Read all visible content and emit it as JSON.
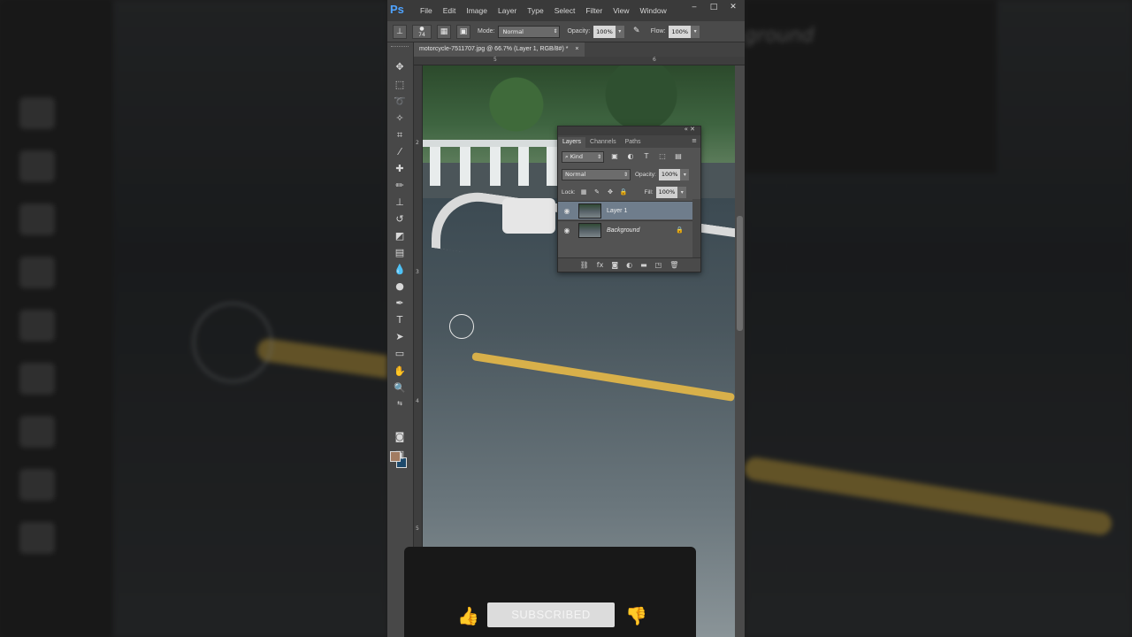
{
  "app": {
    "logo": "Ps",
    "menu": [
      "File",
      "Edit",
      "Image",
      "Layer",
      "Type",
      "Select",
      "Filter",
      "View",
      "Window"
    ],
    "window_controls": [
      "‒",
      "□",
      "✕"
    ]
  },
  "options": {
    "brush_size": "74",
    "mode_label": "Mode:",
    "mode_value": "Normal",
    "opacity_label": "Opacity:",
    "opacity_value": "100%",
    "flow_label": "Flow:",
    "flow_value": "100%"
  },
  "document": {
    "tab_title": "motorcycle-7511707.jpg @ 66.7% (Layer 1, RGB/8#) *",
    "tab_close": "×",
    "ruler_top": [
      "5",
      "6"
    ],
    "ruler_left": [
      "2",
      "3",
      "4",
      "5"
    ]
  },
  "colors": {
    "foreground": "#a27c62",
    "background": "#1e4a6c",
    "accent": "#4fa3ff"
  },
  "layers_panel": {
    "tabs": [
      "Layers",
      "Channels",
      "Paths"
    ],
    "filter_value": "Kind",
    "blend_mode": "Normal",
    "opacity_label": "Opacity:",
    "opacity_value": "100%",
    "lock_label": "Lock:",
    "fill_label": "Fill:",
    "fill_value": "100%",
    "layers": [
      {
        "name": "Layer 1",
        "selected": true,
        "locked": false
      },
      {
        "name": "Background",
        "selected": false,
        "locked": true
      }
    ]
  },
  "background_panel_text": "ground",
  "subscribe": {
    "label": "SUBSCRIBED"
  }
}
